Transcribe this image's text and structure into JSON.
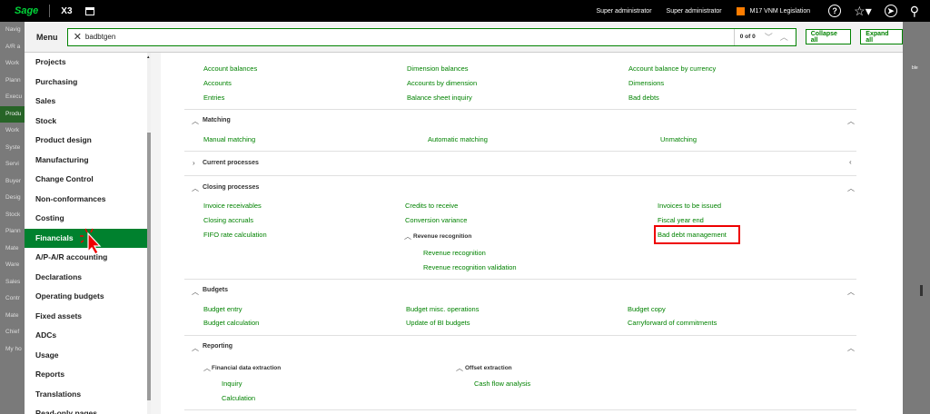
{
  "topbar": {
    "logo": "Sage",
    "product": "X3",
    "user1": "Super administrator",
    "user2": "Super administrator",
    "legislation": "M17 VNM Legislation"
  },
  "bg_left": [
    "Navig",
    "A/R a",
    "Work",
    "Plann",
    "Execu",
    "Produ",
    "Work",
    "Syste",
    "Servi",
    "Buyer",
    "Desig",
    "Stock",
    "Plann",
    "Mate",
    "Ware",
    "Sales",
    "Contr",
    "Mate",
    "Chief",
    "My ho"
  ],
  "menu": {
    "title": "Menu",
    "search_value": "badbtgen",
    "count": "0 of 0",
    "collapse_all": "Collapse all",
    "expand_all": "Expand all"
  },
  "sidebar": [
    "Projects",
    "Purchasing",
    "Sales",
    "Stock",
    "Product design",
    "Manufacturing",
    "Change Control",
    "Non-conformances",
    "Costing",
    "Financials",
    "A/P-A/R accounting",
    "Declarations",
    "Operating budgets",
    "Fixed assets",
    "ADCs",
    "Usage",
    "Reports",
    "Translations",
    "Read-only pages"
  ],
  "content": {
    "top_links": {
      "col1": [
        "Account balances",
        "Accounts",
        "Entries"
      ],
      "col2": [
        "Dimension balances",
        "Accounts by dimension",
        "Balance sheet inquiry"
      ],
      "col3": [
        "Account balance by currency",
        "Dimensions",
        "Bad debts"
      ]
    },
    "matching": {
      "title": "Matching",
      "links": [
        "Manual matching",
        "Automatic matching",
        "Unmatching"
      ]
    },
    "current_processes": {
      "title": "Current processes"
    },
    "closing": {
      "title": "Closing processes",
      "col1": [
        "Invoice receivables",
        "Closing accruals",
        "FIFO rate calculation"
      ],
      "col2": [
        "Credits to receive",
        "Conversion variance"
      ],
      "col3": [
        "Invoices to be issued",
        "Fiscal year end",
        "Bad debt management"
      ],
      "sub_title": "Revenue recognition",
      "sub_links": [
        "Revenue recognition",
        "Revenue recognition validation"
      ]
    },
    "budgets": {
      "title": "Budgets",
      "col1": [
        "Budget entry",
        "Budget calculation"
      ],
      "col2": [
        "Budget misc. operations",
        "Update of BI budgets"
      ],
      "col3": [
        "Budget copy",
        "Carryforward of commitments"
      ]
    },
    "reporting": {
      "title": "Reporting",
      "sub1_title": "Financial data extraction",
      "sub1_links": [
        "Inquiry",
        "Calculation"
      ],
      "sub2_title": "Offset extraction",
      "sub2_links": [
        "Cash flow analysis"
      ]
    }
  },
  "colors": {
    "accent": "#008200",
    "active": "#00812e",
    "highlight_box": "#e00000"
  }
}
